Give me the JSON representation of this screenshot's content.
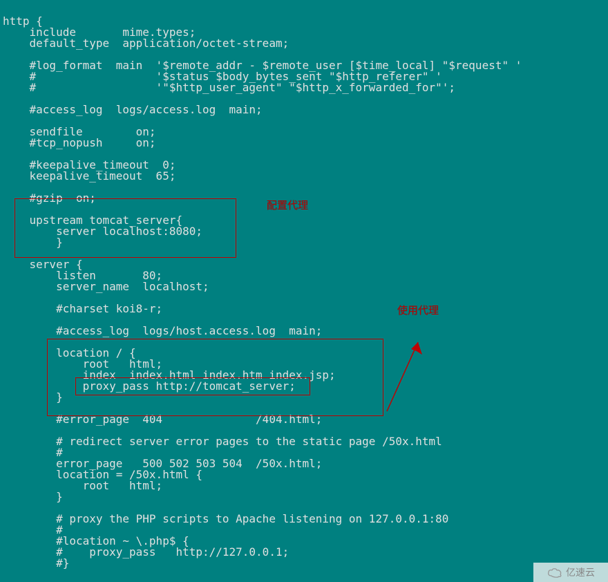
{
  "config_lines": [
    "http {",
    "    include       mime.types;",
    "    default_type  application/octet-stream;",
    "",
    "    #log_format  main  '$remote_addr - $remote_user [$time_local] \"$request\" '",
    "    #                  '$status $body_bytes_sent \"$http_referer\" '",
    "    #                  '\"$http_user_agent\" \"$http_x_forwarded_for\"';",
    "",
    "    #access_log  logs/access.log  main;",
    "",
    "    sendfile        on;",
    "    #tcp_nopush     on;",
    "",
    "    #keepalive_timeout  0;",
    "    keepalive_timeout  65;",
    "",
    "    #gzip  on;",
    "",
    "    upstream tomcat_server{",
    "        server localhost:8080;",
    "        }",
    "",
    "    server {",
    "        listen       80;",
    "        server_name  localhost;",
    "",
    "        #charset koi8-r;",
    "",
    "        #access_log  logs/host.access.log  main;",
    "",
    "        location / {",
    "            root   html;",
    "            index  index.html index.htm index.jsp;",
    "            proxy_pass http://tomcat_server;",
    "        }",
    "",
    "        #error_page  404              /404.html;",
    "",
    "        # redirect server error pages to the static page /50x.html",
    "        #",
    "        error_page   500 502 503 504  /50x.html;",
    "        location = /50x.html {",
    "            root   html;",
    "        }",
    "",
    "        # proxy the PHP scripts to Apache listening on 127.0.0.1:80",
    "        #",
    "        #location ~ \\.php$ {",
    "        #    proxy_pass   http://127.0.0.1;",
    "        #}",
    ""
  ],
  "annotations": {
    "configure_proxy": "配置代理",
    "use_proxy": "使用代理"
  },
  "watermark": {
    "text": "亿速云"
  },
  "colors": {
    "background": "#008080",
    "text": "#e0e0e0",
    "annotation": "#c00000"
  }
}
